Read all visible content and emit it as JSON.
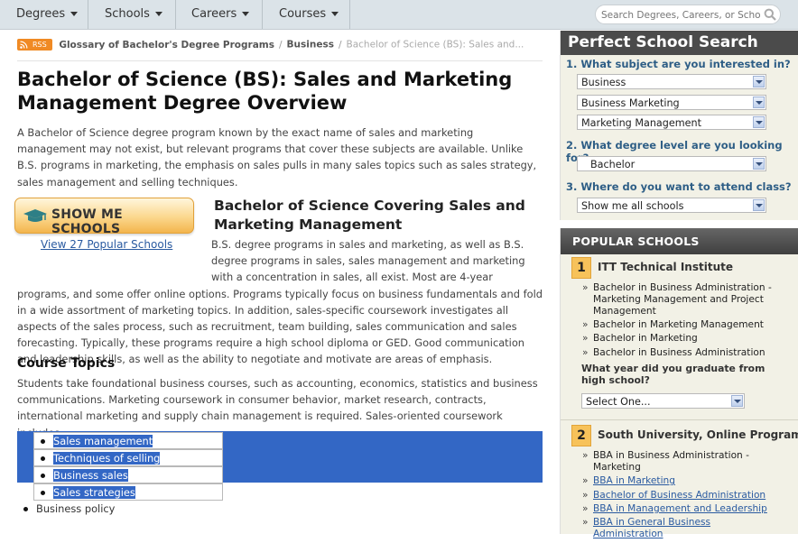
{
  "nav": {
    "items": [
      {
        "label": "Degrees"
      },
      {
        "label": "Schools"
      },
      {
        "label": "Careers"
      },
      {
        "label": "Courses"
      }
    ],
    "search_placeholder": "Search Degrees, Careers, or Schools"
  },
  "breadcrumb": {
    "rss": "RSS",
    "items": [
      "Glossary of Bachelor's Degree Programs",
      "Business"
    ],
    "current": "Bachelor of Science (BS): Sales and..."
  },
  "article": {
    "title": "Bachelor of Science (BS): Sales and Marketing Management Degree Overview",
    "intro": "A Bachelor of Science degree program known by the exact name of sales and marketing management may not exist, but relevant programs that cover these subjects are available. Unlike B.S. programs in marketing, the emphasis on sales pulls in many sales topics such as sales strategy, sales management and selling techniques.",
    "show_me_schools": "SHOW ME SCHOOLS",
    "popular_link": "View 27 Popular Schools",
    "section_title": "Bachelor of Science Covering Sales and Marketing Management",
    "section_body": "B.S. degree programs in sales and marketing, as well as B.S. degree programs in sales, sales management and marketing with a concentration in sales, all exist. Most are 4-year programs, and some offer online options. Programs typically focus on business fundamentals and fold in a wide assortment of marketing topics. In addition, sales-specific coursework investigates all aspects of the sales process, such as recruitment, team building, sales communication and sales forecasting. Typically, these programs require a high school diploma or GED. Good communication and leadership skills, as well as the ability to negotiate and motivate are areas of emphasis.",
    "topics_title": "Course Topics",
    "topics_body": "Students take foundational business courses, such as accounting, economics, statistics and business communications. Marketing coursework in consumer behavior, market research, contracts, international marketing and supply chain management is required. Sales-oriented coursework includes:",
    "topics_list": [
      "Sales management",
      "Techniques of selling",
      "Business sales",
      "Sales strategies",
      "Business policy"
    ]
  },
  "perfect_search": {
    "title": "Perfect School Search",
    "q1": "1. What subject are you interested in?",
    "q1_values": [
      "Business",
      "Business Marketing",
      "Marketing Management"
    ],
    "q2": "2. What degree level are you looking for?",
    "q2_value": "Bachelor",
    "q3": "3. Where do you want to attend class?",
    "q3_value": "Show me all schools"
  },
  "popular_schools": {
    "title": "POPULAR SCHOOLS",
    "schools": [
      {
        "num": "1",
        "name": "ITT Technical Institute",
        "programs": [
          "Bachelor in Business Administration - Marketing Management and Project Management",
          "Bachelor in Marketing Management",
          "Bachelor in Marketing",
          "Bachelor in Business Administration"
        ],
        "grad_question": "What year did you graduate from high school?",
        "grad_select": "Select One..."
      },
      {
        "num": "2",
        "name": "South University, Online Programs",
        "programs": [
          "BBA in Business Administration - Marketing",
          "BBA in Marketing",
          "Bachelor of Business Administration",
          "BBA in Management and Leadership",
          "BBA in General Business Administration"
        ]
      }
    ]
  }
}
